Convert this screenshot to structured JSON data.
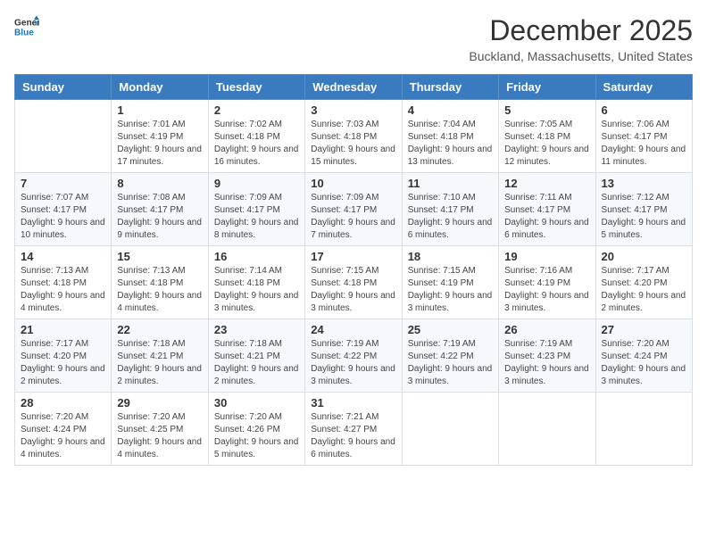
{
  "logo": {
    "line1": "General",
    "line2": "Blue"
  },
  "title": "December 2025",
  "location": "Buckland, Massachusetts, United States",
  "days_of_week": [
    "Sunday",
    "Monday",
    "Tuesday",
    "Wednesday",
    "Thursday",
    "Friday",
    "Saturday"
  ],
  "weeks": [
    [
      {
        "day": "",
        "sunrise": "",
        "sunset": "",
        "daylight": "",
        "empty": true
      },
      {
        "day": "1",
        "sunrise": "Sunrise: 7:01 AM",
        "sunset": "Sunset: 4:19 PM",
        "daylight": "Daylight: 9 hours and 17 minutes.",
        "empty": false
      },
      {
        "day": "2",
        "sunrise": "Sunrise: 7:02 AM",
        "sunset": "Sunset: 4:18 PM",
        "daylight": "Daylight: 9 hours and 16 minutes.",
        "empty": false
      },
      {
        "day": "3",
        "sunrise": "Sunrise: 7:03 AM",
        "sunset": "Sunset: 4:18 PM",
        "daylight": "Daylight: 9 hours and 15 minutes.",
        "empty": false
      },
      {
        "day": "4",
        "sunrise": "Sunrise: 7:04 AM",
        "sunset": "Sunset: 4:18 PM",
        "daylight": "Daylight: 9 hours and 13 minutes.",
        "empty": false
      },
      {
        "day": "5",
        "sunrise": "Sunrise: 7:05 AM",
        "sunset": "Sunset: 4:18 PM",
        "daylight": "Daylight: 9 hours and 12 minutes.",
        "empty": false
      },
      {
        "day": "6",
        "sunrise": "Sunrise: 7:06 AM",
        "sunset": "Sunset: 4:17 PM",
        "daylight": "Daylight: 9 hours and 11 minutes.",
        "empty": false
      }
    ],
    [
      {
        "day": "7",
        "sunrise": "Sunrise: 7:07 AM",
        "sunset": "Sunset: 4:17 PM",
        "daylight": "Daylight: 9 hours and 10 minutes.",
        "empty": false
      },
      {
        "day": "8",
        "sunrise": "Sunrise: 7:08 AM",
        "sunset": "Sunset: 4:17 PM",
        "daylight": "Daylight: 9 hours and 9 minutes.",
        "empty": false
      },
      {
        "day": "9",
        "sunrise": "Sunrise: 7:09 AM",
        "sunset": "Sunset: 4:17 PM",
        "daylight": "Daylight: 9 hours and 8 minutes.",
        "empty": false
      },
      {
        "day": "10",
        "sunrise": "Sunrise: 7:09 AM",
        "sunset": "Sunset: 4:17 PM",
        "daylight": "Daylight: 9 hours and 7 minutes.",
        "empty": false
      },
      {
        "day": "11",
        "sunrise": "Sunrise: 7:10 AM",
        "sunset": "Sunset: 4:17 PM",
        "daylight": "Daylight: 9 hours and 6 minutes.",
        "empty": false
      },
      {
        "day": "12",
        "sunrise": "Sunrise: 7:11 AM",
        "sunset": "Sunset: 4:17 PM",
        "daylight": "Daylight: 9 hours and 6 minutes.",
        "empty": false
      },
      {
        "day": "13",
        "sunrise": "Sunrise: 7:12 AM",
        "sunset": "Sunset: 4:17 PM",
        "daylight": "Daylight: 9 hours and 5 minutes.",
        "empty": false
      }
    ],
    [
      {
        "day": "14",
        "sunrise": "Sunrise: 7:13 AM",
        "sunset": "Sunset: 4:18 PM",
        "daylight": "Daylight: 9 hours and 4 minutes.",
        "empty": false
      },
      {
        "day": "15",
        "sunrise": "Sunrise: 7:13 AM",
        "sunset": "Sunset: 4:18 PM",
        "daylight": "Daylight: 9 hours and 4 minutes.",
        "empty": false
      },
      {
        "day": "16",
        "sunrise": "Sunrise: 7:14 AM",
        "sunset": "Sunset: 4:18 PM",
        "daylight": "Daylight: 9 hours and 3 minutes.",
        "empty": false
      },
      {
        "day": "17",
        "sunrise": "Sunrise: 7:15 AM",
        "sunset": "Sunset: 4:18 PM",
        "daylight": "Daylight: 9 hours and 3 minutes.",
        "empty": false
      },
      {
        "day": "18",
        "sunrise": "Sunrise: 7:15 AM",
        "sunset": "Sunset: 4:19 PM",
        "daylight": "Daylight: 9 hours and 3 minutes.",
        "empty": false
      },
      {
        "day": "19",
        "sunrise": "Sunrise: 7:16 AM",
        "sunset": "Sunset: 4:19 PM",
        "daylight": "Daylight: 9 hours and 3 minutes.",
        "empty": false
      },
      {
        "day": "20",
        "sunrise": "Sunrise: 7:17 AM",
        "sunset": "Sunset: 4:20 PM",
        "daylight": "Daylight: 9 hours and 2 minutes.",
        "empty": false
      }
    ],
    [
      {
        "day": "21",
        "sunrise": "Sunrise: 7:17 AM",
        "sunset": "Sunset: 4:20 PM",
        "daylight": "Daylight: 9 hours and 2 minutes.",
        "empty": false
      },
      {
        "day": "22",
        "sunrise": "Sunrise: 7:18 AM",
        "sunset": "Sunset: 4:21 PM",
        "daylight": "Daylight: 9 hours and 2 minutes.",
        "empty": false
      },
      {
        "day": "23",
        "sunrise": "Sunrise: 7:18 AM",
        "sunset": "Sunset: 4:21 PM",
        "daylight": "Daylight: 9 hours and 2 minutes.",
        "empty": false
      },
      {
        "day": "24",
        "sunrise": "Sunrise: 7:19 AM",
        "sunset": "Sunset: 4:22 PM",
        "daylight": "Daylight: 9 hours and 3 minutes.",
        "empty": false
      },
      {
        "day": "25",
        "sunrise": "Sunrise: 7:19 AM",
        "sunset": "Sunset: 4:22 PM",
        "daylight": "Daylight: 9 hours and 3 minutes.",
        "empty": false
      },
      {
        "day": "26",
        "sunrise": "Sunrise: 7:19 AM",
        "sunset": "Sunset: 4:23 PM",
        "daylight": "Daylight: 9 hours and 3 minutes.",
        "empty": false
      },
      {
        "day": "27",
        "sunrise": "Sunrise: 7:20 AM",
        "sunset": "Sunset: 4:24 PM",
        "daylight": "Daylight: 9 hours and 3 minutes.",
        "empty": false
      }
    ],
    [
      {
        "day": "28",
        "sunrise": "Sunrise: 7:20 AM",
        "sunset": "Sunset: 4:24 PM",
        "daylight": "Daylight: 9 hours and 4 minutes.",
        "empty": false
      },
      {
        "day": "29",
        "sunrise": "Sunrise: 7:20 AM",
        "sunset": "Sunset: 4:25 PM",
        "daylight": "Daylight: 9 hours and 4 minutes.",
        "empty": false
      },
      {
        "day": "30",
        "sunrise": "Sunrise: 7:20 AM",
        "sunset": "Sunset: 4:26 PM",
        "daylight": "Daylight: 9 hours and 5 minutes.",
        "empty": false
      },
      {
        "day": "31",
        "sunrise": "Sunrise: 7:21 AM",
        "sunset": "Sunset: 4:27 PM",
        "daylight": "Daylight: 9 hours and 6 minutes.",
        "empty": false
      },
      {
        "day": "",
        "sunrise": "",
        "sunset": "",
        "daylight": "",
        "empty": true
      },
      {
        "day": "",
        "sunrise": "",
        "sunset": "",
        "daylight": "",
        "empty": true
      },
      {
        "day": "",
        "sunrise": "",
        "sunset": "",
        "daylight": "",
        "empty": true
      }
    ]
  ]
}
